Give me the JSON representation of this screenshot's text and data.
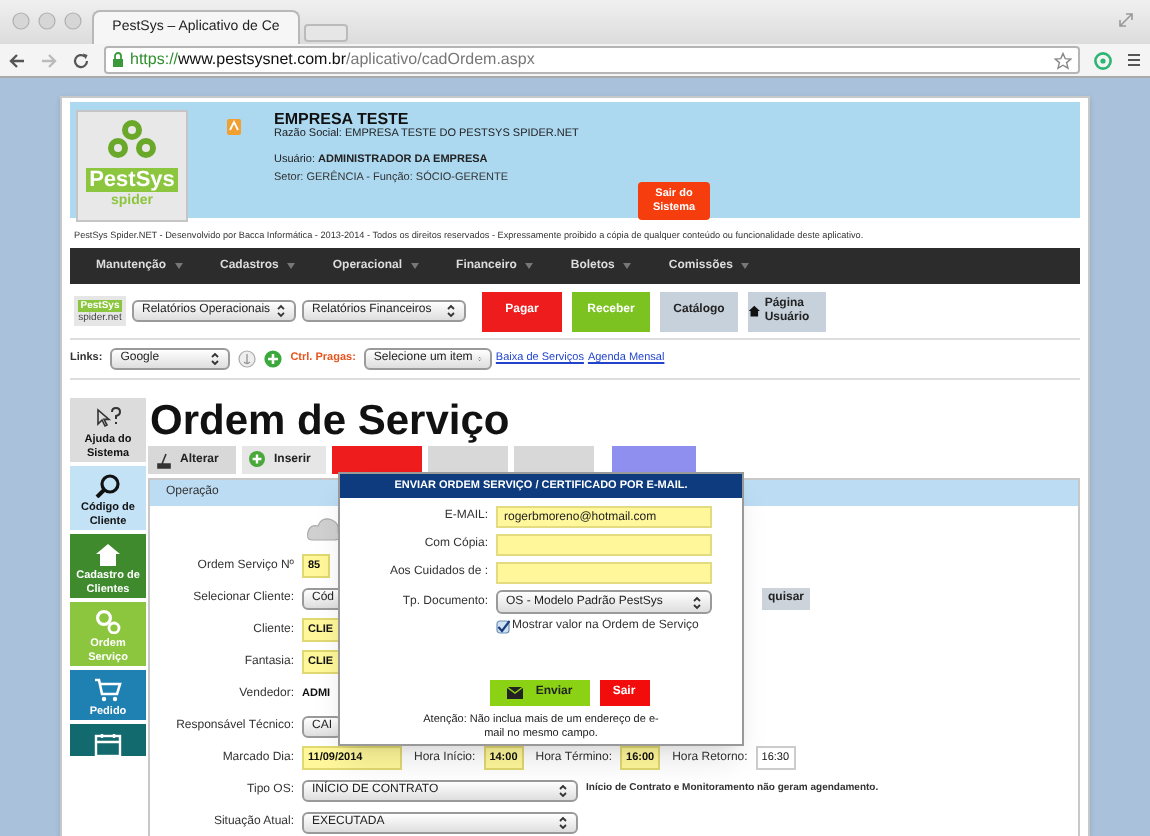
{
  "browser": {
    "tab_title": "PestSys – Aplicativo de Ce",
    "url": {
      "scheme": "https://",
      "host": "www.pestsysnet.com.br",
      "path": "/aplicativo/cadOrdem.aspx"
    }
  },
  "header": {
    "logo": {
      "name": "PestSys",
      "tagline": "spider"
    },
    "company": "EMPRESA TESTE",
    "razao_social": "Razão Social: EMPRESA TESTE DO PESTSYS SPIDER.NET",
    "user": "Usuário: **ADMINISTRADOR DA EMPRESA**",
    "sector": "Setor: GERÊNCIA - Função: SÓCIO-GERENTE",
    "logout_button": "Sair do Sistema"
  },
  "footer_note": "PestSys Spider.NET - Desenvolvido por Bacca Informática - 2013-2014 - Todos os direitos reservados - Expressamente proibido a cópia de qualquer conteúdo ou funcionalidade deste aplicativo.",
  "menu": [
    "Manutenção",
    "Cadastros",
    "Operacional",
    "Financeiro",
    "Boletos",
    "Comissões"
  ],
  "toolbar": {
    "logo": {
      "name": "PestSys",
      "tagline": "spider.net"
    },
    "selects": [
      "Relatórios Operacionais",
      "Relatórios Financeiros"
    ],
    "buttons": [
      {
        "label": "Pagar",
        "kind": "pay"
      },
      {
        "label": "Receber",
        "kind": "receive"
      },
      {
        "label": "Catálogo",
        "kind": "catalog"
      },
      {
        "label": "Página Usuário",
        "kind": "home"
      }
    ]
  },
  "links_bar": {
    "label": "Links:",
    "links_select": "Google",
    "pests_label": "Ctrl. Pragas:",
    "pests_select": "Selecione um item",
    "links": [
      "Baixa de Serviços",
      "Agenda Mensal"
    ]
  },
  "sidebar": [
    {
      "label": "Ajuda do Sistema",
      "kind": "help"
    },
    {
      "label": "Código de Cliente",
      "kind": "search"
    },
    {
      "label": "Cadastro de Clientes",
      "kind": "home"
    },
    {
      "label": "Ordem Serviço",
      "kind": "gears"
    },
    {
      "label": "Pedido",
      "kind": "cart"
    },
    {
      "kind": "calendar"
    }
  ],
  "page_title": "Ordem de Serviço",
  "actions": [
    {
      "label": "Alterar",
      "kind": "edit"
    },
    {
      "label": "Inserir",
      "kind": "add"
    },
    {
      "kind": "delete"
    },
    {
      "kind": "plain"
    },
    {
      "kind": "plain"
    },
    {
      "kind": "mail"
    }
  ],
  "section_label": "Operação",
  "form": [
    {
      "label": "Ordem Serviço Nº",
      "items": [
        {
          "kind": "input",
          "value": "85",
          "highlighted": true
        }
      ]
    },
    {
      "label": "Selecionar Cliente:",
      "items": [
        {
          "kind": "select",
          "value": "Cód"
        },
        {
          "kind": "button",
          "value": "quisar"
        }
      ]
    },
    {
      "label": "Cliente:",
      "items": [
        {
          "kind": "input",
          "value": "CLIE",
          "highlighted": true
        }
      ]
    },
    {
      "label": "Fantasia:",
      "items": [
        {
          "kind": "input",
          "value": "CLIE",
          "highlighted": true
        }
      ]
    },
    {
      "label": "Vendedor:",
      "items": [
        {
          "kind": "text",
          "value": "ADMI"
        }
      ]
    },
    {
      "label": "Responsável Técnico:",
      "items": [
        {
          "kind": "select",
          "value": "CAI"
        }
      ]
    },
    {
      "label": "Marcado Dia:",
      "items": [
        {
          "kind": "input",
          "value": "11/09/2014",
          "highlighted": true
        },
        {
          "kind": "label",
          "value": "Hora Início:"
        },
        {
          "kind": "input",
          "value": "14:00",
          "highlighted": true
        },
        {
          "kind": "label",
          "value": "Hora Término:"
        },
        {
          "kind": "input",
          "value": "16:00",
          "highlighted": true
        },
        {
          "kind": "label",
          "value": "Hora Retorno:"
        },
        {
          "kind": "input",
          "value": "16:30",
          "highlighted": false
        }
      ]
    },
    {
      "label": "Tipo OS:",
      "items": [
        {
          "kind": "select",
          "value": "INÍCIO DE CONTRATO"
        },
        {
          "kind": "note",
          "value": "Início de Contrato e Monitoramento não geram agendamento."
        }
      ]
    },
    {
      "label": "Situação Atual:",
      "items": [
        {
          "kind": "select",
          "value": "EXECUTADA"
        }
      ]
    }
  ],
  "dialog": {
    "title": "ENVIAR ORDEM SERVIÇO / CERTIFICADO POR E-MAIL.",
    "fields": [
      {
        "label": "E-MAIL:",
        "kind": "input",
        "value": "rogerbmoreno@hotmail.com"
      },
      {
        "label": "Com Cópia:",
        "kind": "input"
      },
      {
        "label": "Aos Cuidados de :",
        "kind": "input"
      },
      {
        "label": "Tp. Documento:",
        "kind": "select",
        "value": "OS - Modelo Padrão PestSys"
      }
    ],
    "checkbox": {
      "label": "Mostrar valor na Ordem de Serviço",
      "checked": true
    },
    "buttons": [
      {
        "label": "Enviar",
        "kind": "send"
      },
      {
        "label": "Sair",
        "kind": "exit"
      }
    ],
    "note": "Atenção: Não inclua mais de um endereço de e-mail no mesmo campo."
  }
}
